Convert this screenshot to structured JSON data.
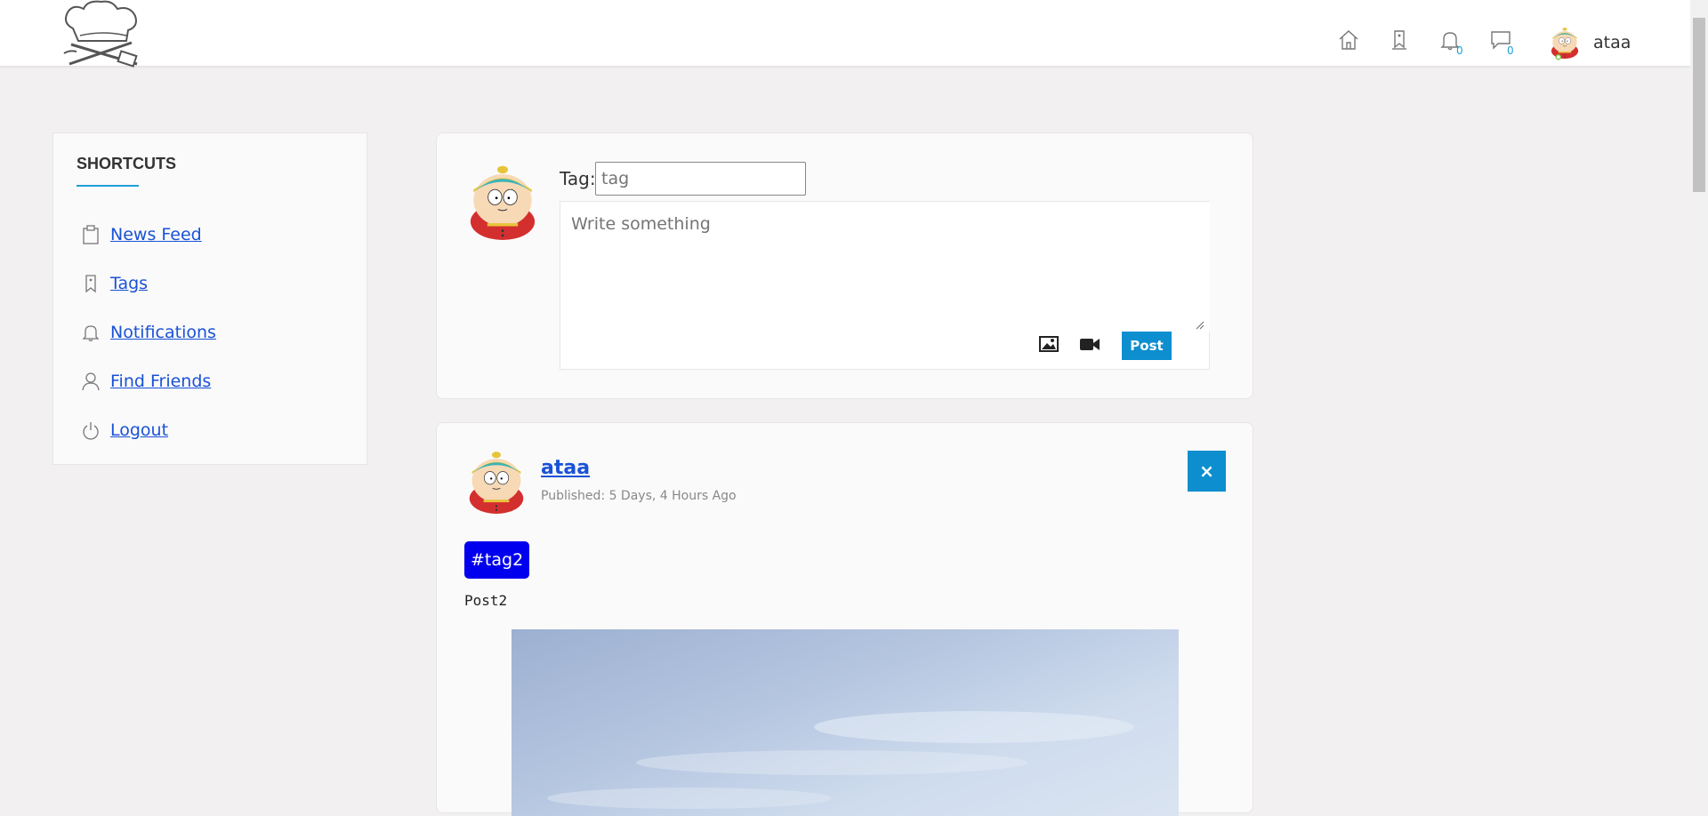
{
  "header": {
    "logo_icon": "chef-hat-utensils-logo",
    "nav_icons": [
      {
        "name": "home-icon"
      },
      {
        "name": "tag-icon"
      },
      {
        "name": "bell-icon",
        "count": "0"
      },
      {
        "name": "chat-icon",
        "count": "0"
      }
    ],
    "user": {
      "name": "ataa",
      "avatar": "cartman-avatar"
    }
  },
  "shortcuts": {
    "title": "SHORTCUTS",
    "items": [
      {
        "label": "News Feed",
        "icon": "clipboard-icon"
      },
      {
        "label": "Tags",
        "icon": "tag-icon"
      },
      {
        "label": "Notifications",
        "icon": "bell-icon"
      },
      {
        "label": "Find Friends",
        "icon": "user-icon"
      },
      {
        "label": "Logout",
        "icon": "power-icon"
      }
    ]
  },
  "composer": {
    "tag_label": "Tag:",
    "tag_placeholder": "tag",
    "text_placeholder": "Write something",
    "image_icon": "image-icon",
    "video_icon": "video-camera-icon",
    "post_label": "Post"
  },
  "post": {
    "author": "ataa",
    "published": "Published: 5 Days, 4 Hours Ago",
    "delete_label": "×",
    "tag": "#tag2",
    "text": "Post2",
    "image": "sky-photo"
  },
  "colors": {
    "accent": "#0c8ecf",
    "link": "#1a52d6",
    "tag_badge": "#0000ee",
    "count": "#1e9fd6",
    "background": "#f2f0f1"
  }
}
